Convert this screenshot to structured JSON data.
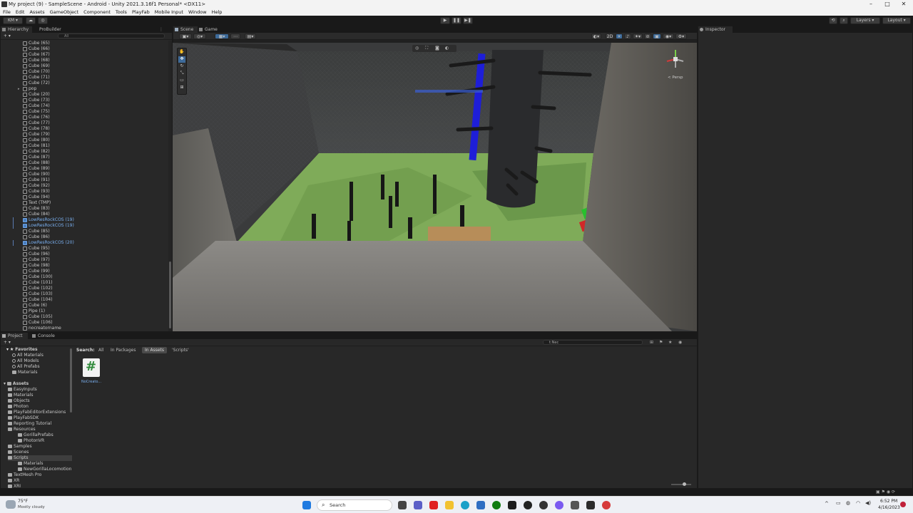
{
  "window": {
    "title": "My project (9) - SampleScene - Android - Unity 2021.3.16f1 Personal* <DX11>",
    "controls": [
      "–",
      "□",
      "✕"
    ]
  },
  "menu": [
    "File",
    "Edit",
    "Assets",
    "GameObject",
    "Component",
    "Tools",
    "PlayFab",
    "Mobile Input",
    "Window",
    "Help"
  ],
  "toolbar": {
    "account": "KM ▾",
    "play": "▶",
    "pause": "❚❚",
    "step": "▶❚",
    "layers": "Layers",
    "layout": "Layout"
  },
  "hierarchy": {
    "tabs": [
      "Hierarchy",
      "ProBuilder"
    ],
    "search_placeholder": "All",
    "add": "+ ▾",
    "rows": [
      {
        "label": "Cube (65)",
        "type": "normal"
      },
      {
        "label": "Cube (66)",
        "type": "normal"
      },
      {
        "label": "Cube (67)",
        "type": "normal"
      },
      {
        "label": "Cube (68)",
        "type": "normal"
      },
      {
        "label": "Cube (69)",
        "type": "normal"
      },
      {
        "label": "Cube (70)",
        "type": "normal"
      },
      {
        "label": "Cube (71)",
        "type": "normal"
      },
      {
        "label": "Cube (72)",
        "type": "normal"
      },
      {
        "label": "pop",
        "type": "folded"
      },
      {
        "label": "Cube (20)",
        "type": "normal"
      },
      {
        "label": "Cube (73)",
        "type": "normal"
      },
      {
        "label": "Cube (74)",
        "type": "normal"
      },
      {
        "label": "Cube (75)",
        "type": "normal"
      },
      {
        "label": "Cube (76)",
        "type": "normal"
      },
      {
        "label": "Cube (77)",
        "type": "normal"
      },
      {
        "label": "Cube (78)",
        "type": "normal"
      },
      {
        "label": "Cube (79)",
        "type": "normal"
      },
      {
        "label": "Cube (80)",
        "type": "normal"
      },
      {
        "label": "Cube (81)",
        "type": "normal"
      },
      {
        "label": "Cube (82)",
        "type": "normal"
      },
      {
        "label": "Cube (87)",
        "type": "normal"
      },
      {
        "label": "Cube (88)",
        "type": "normal"
      },
      {
        "label": "Cube (89)",
        "type": "normal"
      },
      {
        "label": "Cube (90)",
        "type": "normal"
      },
      {
        "label": "Cube (91)",
        "type": "normal"
      },
      {
        "label": "Cube (92)",
        "type": "normal"
      },
      {
        "label": "Cube (93)",
        "type": "normal"
      },
      {
        "label": "Cube (94)",
        "type": "normal"
      },
      {
        "label": "Text (TMP)",
        "type": "normal"
      },
      {
        "label": "Cube (83)",
        "type": "normal"
      },
      {
        "label": "Cube (84)",
        "type": "normal"
      },
      {
        "label": "LowResRockCOS (19)",
        "type": "prefab"
      },
      {
        "label": "LowResRockCOS (19)",
        "type": "prefab"
      },
      {
        "label": "Cube (85)",
        "type": "normal"
      },
      {
        "label": "Cube (86)",
        "type": "normal"
      },
      {
        "label": "LowResRockCOS (20)",
        "type": "prefab"
      },
      {
        "label": "Cube (95)",
        "type": "normal"
      },
      {
        "label": "Cube (96)",
        "type": "normal"
      },
      {
        "label": "Cube (97)",
        "type": "normal"
      },
      {
        "label": "Cube (98)",
        "type": "normal"
      },
      {
        "label": "Cube (99)",
        "type": "normal"
      },
      {
        "label": "Cube (100)",
        "type": "normal"
      },
      {
        "label": "Cube (101)",
        "type": "normal"
      },
      {
        "label": "Cube (102)",
        "type": "normal"
      },
      {
        "label": "Cube (103)",
        "type": "normal"
      },
      {
        "label": "Cube (104)",
        "type": "normal"
      },
      {
        "label": "Cube (6)",
        "type": "normal"
      },
      {
        "label": "Pipe (1)",
        "type": "normal"
      },
      {
        "label": "Cube (105)",
        "type": "normal"
      },
      {
        "label": "Cube (106)",
        "type": "normal"
      },
      {
        "label": "nocreatorname",
        "type": "normal"
      }
    ]
  },
  "scene": {
    "tabs": [
      "Scene",
      "Game"
    ],
    "two_d": "2D",
    "gizmo_label": "< Persp"
  },
  "inspector": {
    "tab": "Inspector"
  },
  "project": {
    "tabs": [
      "Project",
      "Console"
    ],
    "add": "+ ▾",
    "search_value": "t:Nec",
    "search_filters": {
      "label": "Search:",
      "all": "All",
      "packages": "In Packages",
      "assets": "In Assets",
      "scripts": "'Scripts'"
    },
    "favorites": {
      "label": "Favorites",
      "items": [
        "All Materials",
        "All Models",
        "All Prefabs",
        "Materials"
      ]
    },
    "assets": {
      "label": "Assets",
      "items": [
        {
          "label": "EasyInputs",
          "depth": 1
        },
        {
          "label": "Materials",
          "depth": 1
        },
        {
          "label": "Objects",
          "depth": 1
        },
        {
          "label": "Photon",
          "depth": 1
        },
        {
          "label": "PlayFabEditorExtensions",
          "depth": 1
        },
        {
          "label": "PlayFabSDK",
          "depth": 1
        },
        {
          "label": "Reporting Tutorial",
          "depth": 1
        },
        {
          "label": "Resources",
          "depth": 1
        },
        {
          "label": "GorillaPrefabs",
          "depth": 2
        },
        {
          "label": "PhotonVR",
          "depth": 2
        },
        {
          "label": "Samples",
          "depth": 1
        },
        {
          "label": "Scenes",
          "depth": 1
        },
        {
          "label": "Scripts",
          "depth": 1
        },
        {
          "label": "Materials",
          "depth": 2
        },
        {
          "label": "NewGorillaLocomotion",
          "depth": 2
        },
        {
          "label": "TextMesh Pro",
          "depth": 1
        },
        {
          "label": "XR",
          "depth": 1
        },
        {
          "label": "XRI",
          "depth": 1
        }
      ]
    },
    "result_file": {
      "label": "NoCreato..."
    }
  },
  "taskbar": {
    "weather_temp": "75°F",
    "weather_desc": "Mostly cloudy",
    "search": "Search",
    "time": "6:52 PM",
    "date": "4/16/2023"
  },
  "colors": {
    "editor_bg": "#282828",
    "selection_blue": "#2c5d87",
    "prefab_blue": "#7ab0f0",
    "script_green": "#2f8a3a"
  }
}
